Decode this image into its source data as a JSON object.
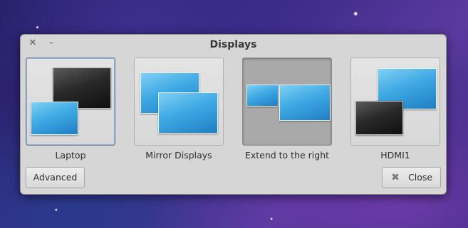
{
  "window": {
    "title": "Displays",
    "close_icon": "close-icon",
    "minimize_icon": "minimize-icon"
  },
  "options": [
    {
      "label": "Laptop",
      "state": "focused"
    },
    {
      "label": "Mirror Displays",
      "state": "normal"
    },
    {
      "label": "Extend to the right",
      "state": "active"
    },
    {
      "label": "HDMI1",
      "state": "normal"
    }
  ],
  "buttons": {
    "advanced_label": "Advanced",
    "close_label": "Close",
    "close_icon": "close-icon"
  }
}
